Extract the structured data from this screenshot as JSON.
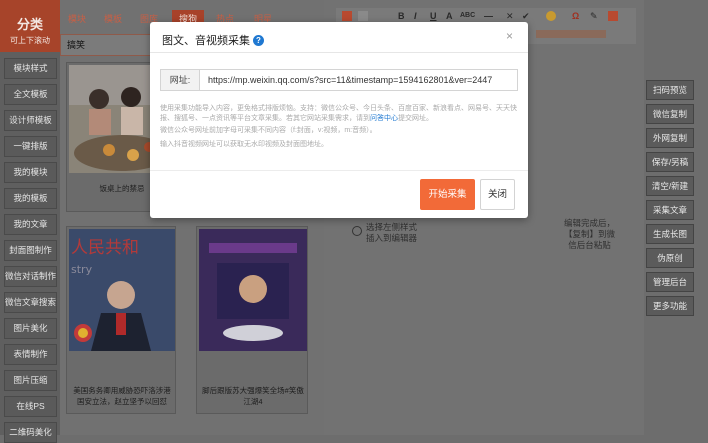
{
  "sidebar": {
    "title": "分类",
    "subtitle": "可上下滚动",
    "items": [
      "模块样式",
      "全文模板",
      "设计师模板",
      "一键排版",
      "我的模块",
      "我的模板",
      "我的文章",
      "封面图制作",
      "微信对话制作",
      "微信文章搜索",
      "图片美化",
      "表情制作",
      "图片压缩",
      "在线PS",
      "二维码美化"
    ]
  },
  "tabs": [
    "模块",
    "模板",
    "图库",
    "搜狗",
    "热点",
    "明星"
  ],
  "active_tab": 3,
  "search": {
    "value": "搞笑"
  },
  "cards": [
    {
      "caption": "饭桌上的禁忌"
    },
    {
      "caption": ""
    },
    {
      "caption": "美国务务卿用威胁恐吓洛涉港国安立法，赵立坚予以回怼"
    },
    {
      "caption": "脚后跟版苏大强爆笑全场#笑傲江湖4"
    }
  ],
  "editor": {
    "toolbar_row1": [
      "B",
      "I",
      "U",
      "A",
      "ABC",
      "—",
      "✕",
      "✔",
      "Ω",
      "✎"
    ],
    "hint_left": [
      "选择左侧样式",
      "插入到编辑器"
    ],
    "hint_right": [
      "编辑完成后，",
      "【复制】到微",
      "信后台粘贴"
    ]
  },
  "right_buttons": [
    "扫码预览",
    "微信复制",
    "外网复制",
    "保存/另稿",
    "清空/新建",
    "采集文章",
    "生成长图",
    "伪原创",
    "管理后台",
    "更多功能"
  ],
  "modal": {
    "title": "图文、音视频采集",
    "help": "?",
    "close": "×",
    "url_label": "网址:",
    "url_value": "https://mp.weixin.qq.com/s?src=11&timestamp=1594162801&ver=2447",
    "note1": "使用采集功能导入内容，更免格式排版烦恼。支持：微信公众号、今日头条、百度百家、新浪看点、网易号、天天快报、搜狐号、一点资讯等平台文章采集。若其它网站采集需求，请到",
    "note1_link": "问答中心",
    "note1_tail": "提交网址。",
    "note2": "微信公众号网址前加字母可采集不同内容（f:封面，v:视频，m:音频）。",
    "note3": "输入抖音视频网址可以获取无水印视频及封面图地址。",
    "start_button": "开始采集",
    "close_button": "关闭"
  },
  "colors": {
    "accent": "#f26a38",
    "sidebar_head": "#a7442a",
    "link": "#1f78d1"
  }
}
